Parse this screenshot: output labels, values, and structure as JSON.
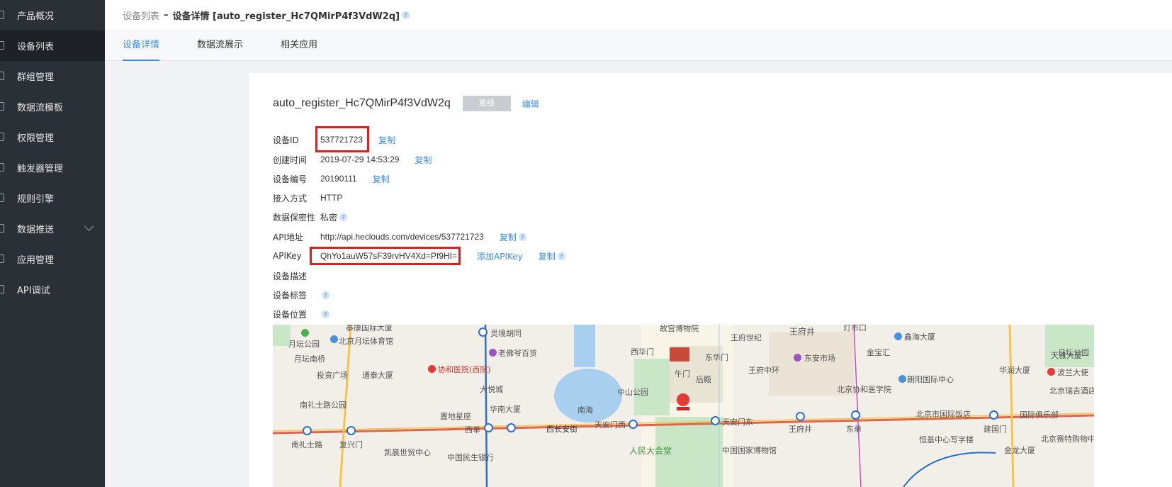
{
  "sidebar": {
    "items": [
      {
        "label": "产品概况"
      },
      {
        "label": "设备列表"
      },
      {
        "label": "群组管理"
      },
      {
        "label": "数据流模板"
      },
      {
        "label": "权限管理"
      },
      {
        "label": "触发器管理"
      },
      {
        "label": "规则引擎"
      },
      {
        "label": "数据推送"
      },
      {
        "label": "应用管理"
      },
      {
        "label": "API调试"
      }
    ]
  },
  "breadcrumb": {
    "parent": "设备列表",
    "separator": "–",
    "current": "设备详情 [auto_register_Hc7QMirP4f3VdW2q]",
    "help": "?"
  },
  "tabs": [
    {
      "label": "设备详情"
    },
    {
      "label": "数据流展示"
    },
    {
      "label": "相关应用"
    }
  ],
  "device": {
    "name": "auto_register_Hc7QMirP4f3VdW2q",
    "status": "离线",
    "edit_label": "编辑"
  },
  "info": {
    "device_id": {
      "label": "设备ID",
      "value": "537721723",
      "copy": "复制"
    },
    "created": {
      "label": "创建时间",
      "value": "2019-07-29 14:53:29",
      "copy": "复制"
    },
    "serial": {
      "label": "设备编号",
      "value": "20190111",
      "copy": "复制"
    },
    "access": {
      "label": "接入方式",
      "value": "HTTP"
    },
    "privacy": {
      "label": "数据保密性",
      "value": "私密"
    },
    "api_url": {
      "label": "API地址",
      "value": "http://api.heclouds.com/devices/537721723",
      "copy": "复制"
    },
    "apikey": {
      "label": "APIKey",
      "value": "QhYo1auW57sF39rvHV4Xd=Pf9HI=",
      "add": "添加APIKey",
      "copy": "复制"
    },
    "desc": {
      "label": "设备描述"
    },
    "tags": {
      "label": "设备标签"
    },
    "location": {
      "label": "设备位置"
    }
  },
  "map": {
    "labels": [
      "月坛公园",
      "北京月坛体育馆",
      "泰康国际大厦",
      "灵境胡同",
      "故宫博物院",
      "王府世纪",
      "王府井",
      "灯市口",
      "鑫海大厦",
      "月坛南桥",
      "老佛爷百货",
      "西华门",
      "东华门",
      "东安市场",
      "金宝汇",
      "天雅大厦",
      "日坛公园",
      "投资广场",
      "协和医院(西院)",
      "午门",
      "王府中环",
      "朗阳国际中心",
      "华润大厦",
      "波兰大使",
      "通泰大厦",
      "大悦城",
      "中山公园",
      "后殿",
      "北京协和医学院",
      "北京瑞吉酒店",
      "南礼士路公园",
      "华南大厦",
      "南海",
      "北京市国际饭店",
      "国际俱乐部",
      "置地星座",
      "西单",
      "西长安街",
      "天安门西",
      "天安门东",
      "王府井",
      "东单",
      "恒基中心写字楼",
      "建国门",
      "北京赛特购物中心",
      "南礼士路",
      "复兴门",
      "凯晨世贸中心",
      "中国民生银行",
      "人民大会堂",
      "中国国家博物馆",
      "金龙大厦"
    ]
  }
}
